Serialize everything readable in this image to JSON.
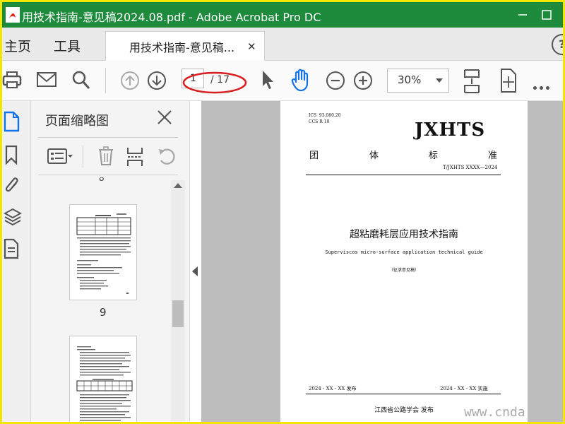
{
  "window": {
    "title": "用技术指南-意见稿2024.08.pdf - Adobe Acrobat Pro DC",
    "title_bar_color": "#1d8a3c",
    "border_color": "#f3e600"
  },
  "tabs": {
    "home": "主页",
    "tools": "工具",
    "document": "用技术指南-意见稿...",
    "close_glyph": "✕",
    "help_glyph": "?"
  },
  "toolbar": {
    "current_page": "1",
    "page_total": "/ 17",
    "zoom": "30%"
  },
  "panel": {
    "title": "页面缩略图",
    "previous_page_number": "8",
    "thumbnail_page_number": "9"
  },
  "document_page": {
    "ics_lines": "ICS  93.080.20\nCCS R 10",
    "brand": "JXHTS",
    "group_chars": [
      "团",
      "体",
      "标",
      "准"
    ],
    "standard_number": "T/JXHTS XXXX—2024",
    "title": "超粘磨耗层应用技术指南",
    "subtitle": "Superviscos micro-surface application technical guide",
    "note": "（征求意见稿）",
    "publish_date": "2024 - XX - XX 发布",
    "implement_date": "2024 - XX - XX 实施",
    "publisher": "江西省公路学会  发布"
  },
  "watermark": "www.cnda",
  "icons": [
    "acrobat-logo-icon",
    "minimize-icon",
    "maximize-icon",
    "print-icon",
    "mail-icon",
    "search-icon",
    "page-up-icon",
    "page-down-icon",
    "select-cursor-icon",
    "hand-tool-icon",
    "zoom-out-icon",
    "zoom-in-icon",
    "fit-page-icon",
    "rotate-view-icon",
    "more-icon",
    "thumbnails-icon",
    "bookmark-icon",
    "attachment-icon",
    "layers-icon",
    "document-properties-icon",
    "page-options-icon",
    "delete-page-icon",
    "insert-page-icon",
    "undo-icon",
    "panel-close-icon"
  ]
}
